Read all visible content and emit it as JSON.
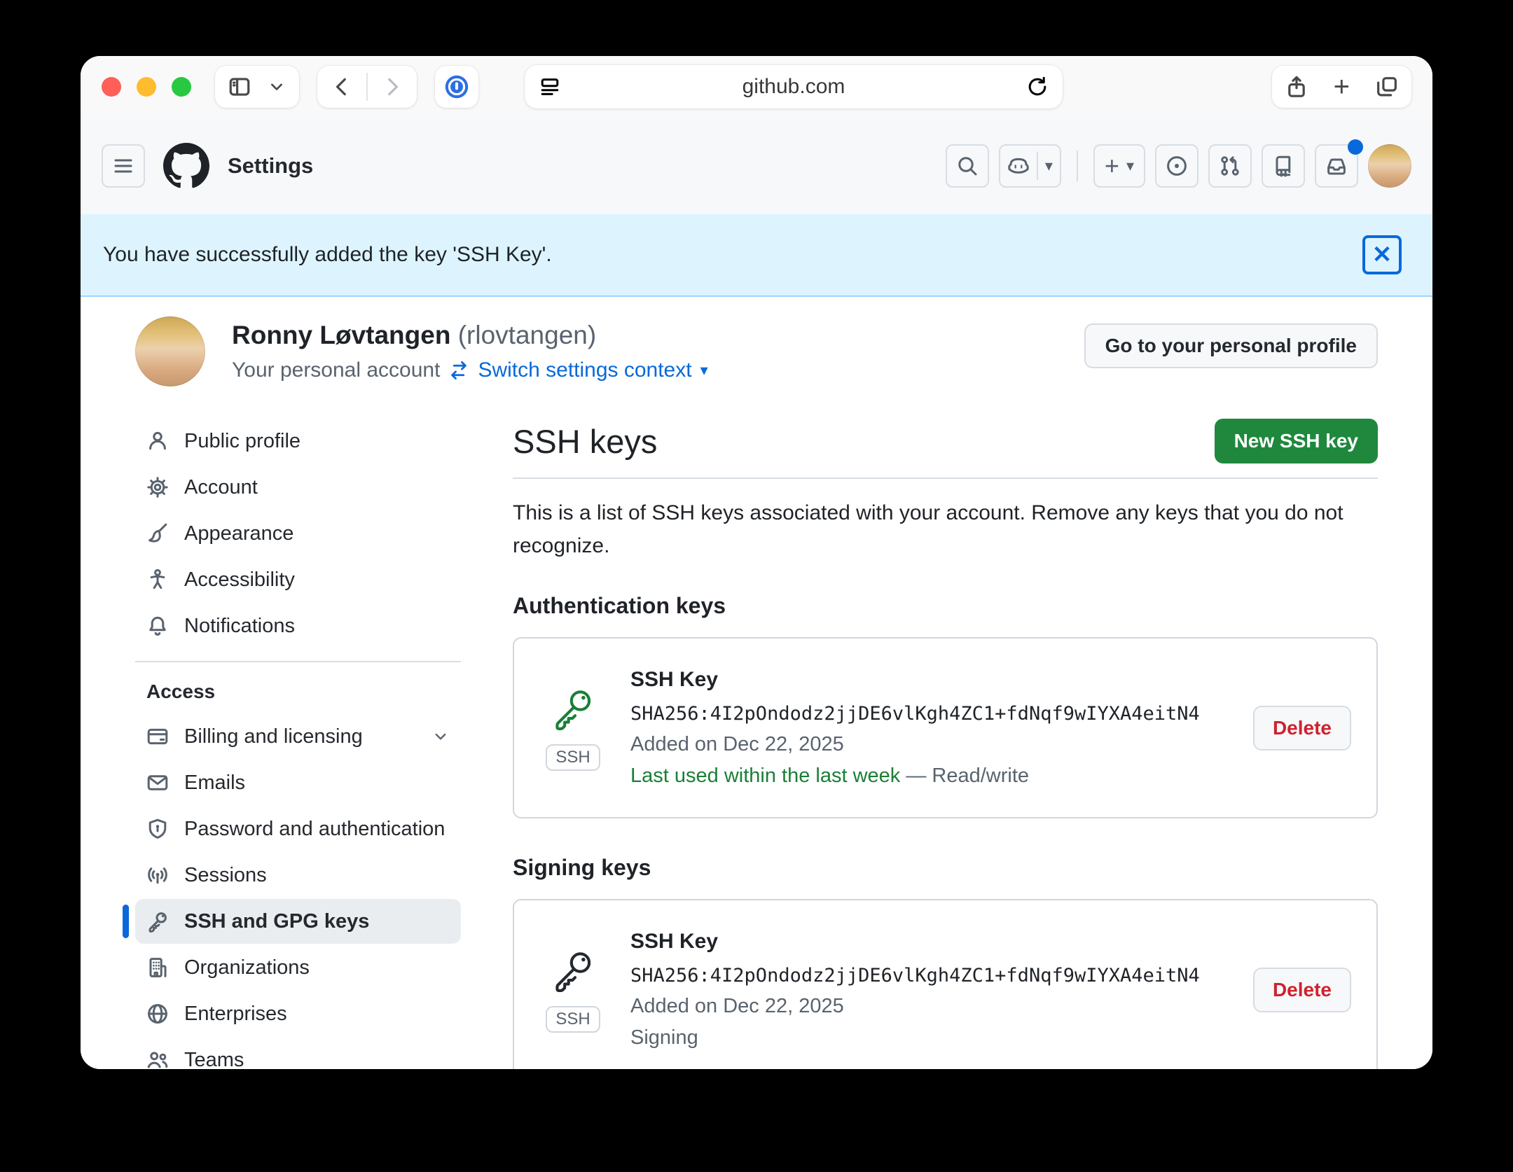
{
  "browser": {
    "url": "github.com"
  },
  "icons": {
    "plus": "+",
    "caret_down": "▾",
    "close": "✕"
  },
  "header": {
    "title": "Settings"
  },
  "flash": {
    "message": "You have successfully added the key 'SSH Key'."
  },
  "profile": {
    "name": "Ronny Løvtangen",
    "username": "(rlovtangen)",
    "account_type": "Your personal account",
    "switch_link": "Switch settings context",
    "go_button": "Go to your personal profile"
  },
  "sidebar": {
    "items": [
      {
        "label": "Public profile"
      },
      {
        "label": "Account"
      },
      {
        "label": "Appearance"
      },
      {
        "label": "Accessibility"
      },
      {
        "label": "Notifications"
      }
    ],
    "access": {
      "label": "Access",
      "items": [
        {
          "label": "Billing and licensing"
        },
        {
          "label": "Emails"
        },
        {
          "label": "Password and authentication"
        },
        {
          "label": "Sessions"
        },
        {
          "label": "SSH and GPG keys"
        },
        {
          "label": "Organizations"
        },
        {
          "label": "Enterprises"
        },
        {
          "label": "Teams"
        }
      ]
    }
  },
  "main": {
    "title": "SSH keys",
    "new_key_button": "New SSH key",
    "description": "This is a list of SSH keys associated with your account. Remove any keys that you do not recognize.",
    "auth_section": {
      "heading": "Authentication keys",
      "key": {
        "title": "SSH Key",
        "fingerprint": "SHA256:4I2pOndodz2jjDE6vlKgh4ZC1+fdNqf9wIYXA4eitN4",
        "added": "Added on Dec 22, 2025",
        "last_used": "Last used within the last week",
        "access_note": "— Read/write",
        "badge": "SSH",
        "delete_button": "Delete"
      }
    },
    "signing_section": {
      "heading": "Signing keys",
      "key": {
        "title": "SSH Key",
        "fingerprint": "SHA256:4I2pOndodz2jjDE6vlKgh4ZC1+fdNqf9wIYXA4eitN4",
        "added": "Added on Dec 22, 2025",
        "usage": "Signing",
        "badge": "SSH",
        "delete_button": "Delete"
      }
    }
  },
  "colors": {
    "accent_blue": "#0969da",
    "success_green": "#1a7f37",
    "button_green": "#1f883d",
    "danger_red": "#cf222e",
    "flash_bg": "#ddf4ff"
  }
}
